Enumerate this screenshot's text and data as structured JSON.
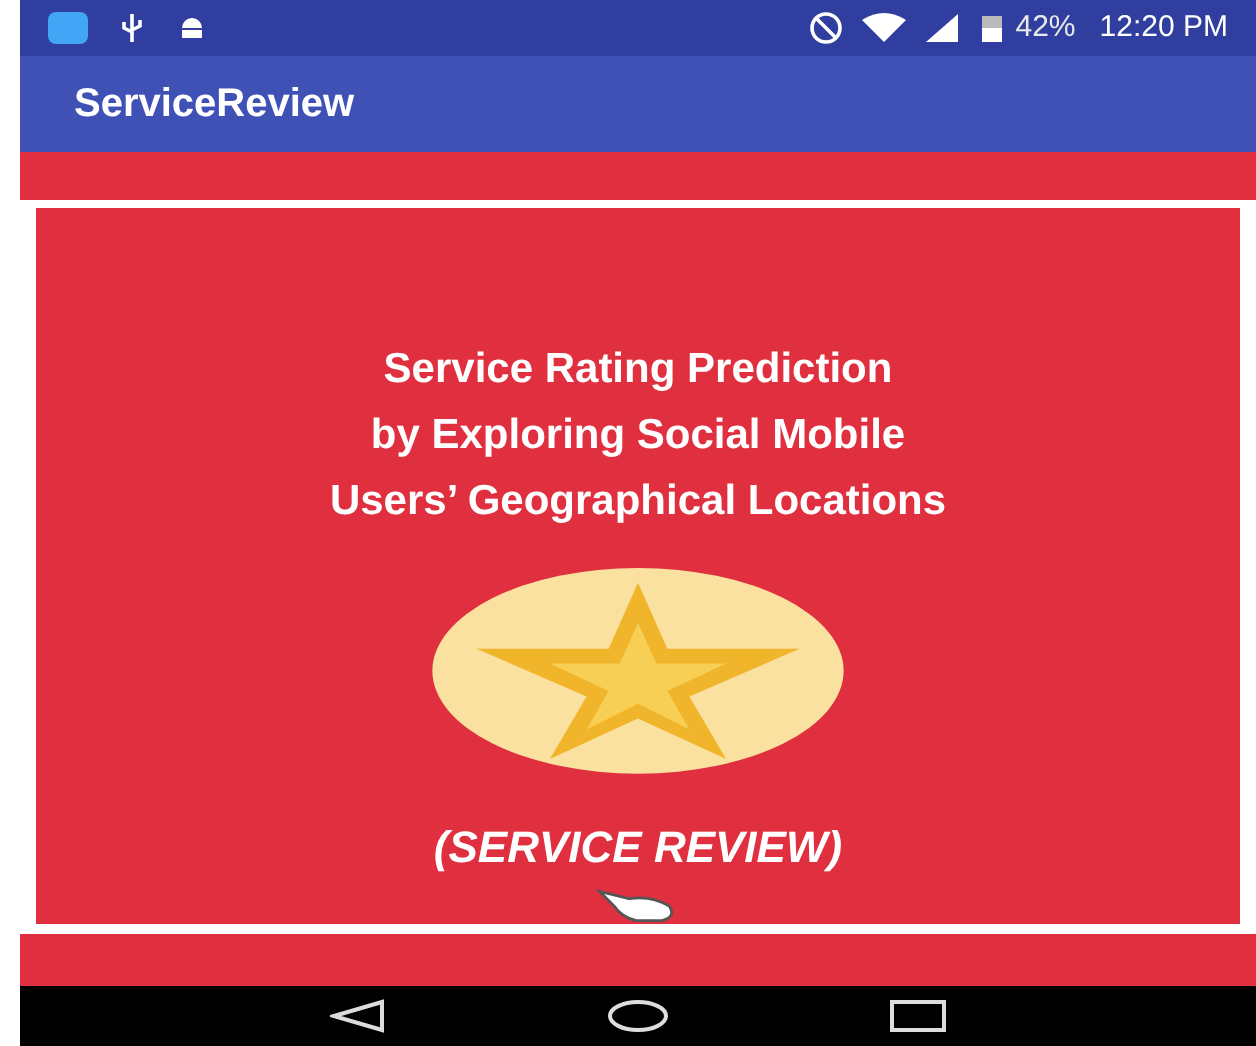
{
  "status_bar": {
    "battery": "42%",
    "time": "12:20 PM"
  },
  "app_bar": {
    "title": "ServiceReview"
  },
  "splash": {
    "title_lines": [
      "Service Rating Prediction",
      "by Exploring Social Mobile",
      "Users’ Geographical Locations"
    ],
    "caption": "(SERVICE REVIEW)"
  }
}
